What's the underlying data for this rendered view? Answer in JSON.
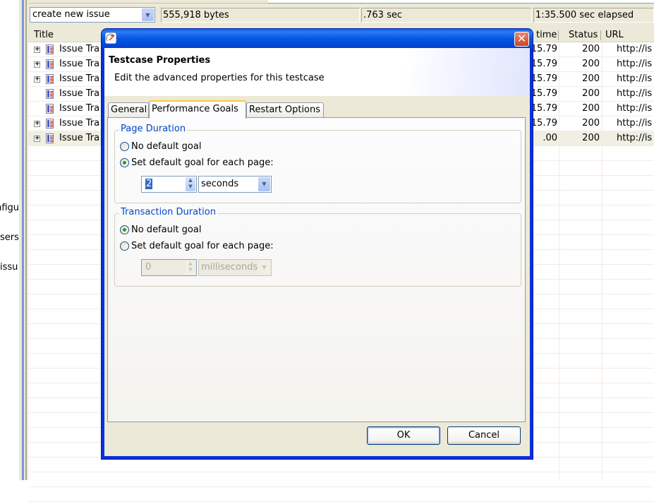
{
  "left_panel": {
    "items": [
      "nfigu",
      "sers",
      "issu"
    ]
  },
  "toolbar": {
    "testcase_combo_value": "create new issue",
    "status_bytes": "555,918 bytes",
    "status_duration": ".763 sec",
    "status_elapsed": "1:35.500 sec elapsed"
  },
  "table": {
    "columns": [
      "Title",
      "time",
      "Status",
      "URL"
    ],
    "rows": [
      {
        "expandable": true,
        "title": "Issue Tra",
        "time": "15.79",
        "status": "200",
        "url": "http://is"
      },
      {
        "expandable": true,
        "title": "Issue Tra",
        "time": "15.79",
        "status": "200",
        "url": "http://is"
      },
      {
        "expandable": true,
        "title": "Issue Tra",
        "time": "15.79",
        "status": "200",
        "url": "http://is"
      },
      {
        "expandable": false,
        "title": "Issue Tra",
        "time": "15.79",
        "status": "200",
        "url": "http://is"
      },
      {
        "expandable": false,
        "title": "Issue Tra",
        "time": "15.79",
        "status": "200",
        "url": "http://is"
      },
      {
        "expandable": true,
        "title": "Issue Tra",
        "time": "15.79",
        "status": "200",
        "url": "http://is"
      },
      {
        "expandable": true,
        "title": "Issue Tra",
        "time": ".00",
        "status": "200",
        "url": "http://is",
        "selected": true
      }
    ]
  },
  "dialog": {
    "window_title": "",
    "close_glyph": "✕",
    "header_title": "Testcase Properties",
    "header_description": "Edit the advanced properties for this testcase",
    "tabs": [
      {
        "label": "General",
        "active": false
      },
      {
        "label": "Performance Goals",
        "active": true
      },
      {
        "label": "Restart Options",
        "active": false
      }
    ],
    "page_duration": {
      "label": "Page Duration",
      "option_none": "No default goal",
      "option_set": "Set default goal for each page:",
      "selected": "set",
      "goal_value": "2",
      "unit": "seconds"
    },
    "transaction_duration": {
      "label": "Transaction Duration",
      "option_none": "No default goal",
      "option_set": "Set default goal for each page:",
      "selected": "none",
      "goal_value": "0",
      "unit": "milliseconds"
    },
    "ok_label": "OK",
    "cancel_label": "Cancel"
  }
}
